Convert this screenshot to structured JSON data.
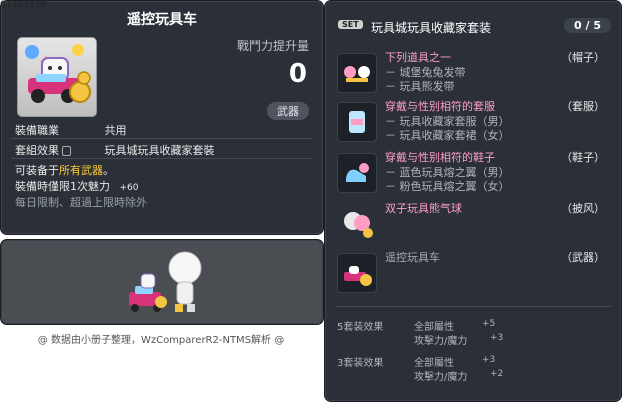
{
  "item_id": "01703339",
  "tooltip": {
    "title": "遥控玩具车",
    "attack_increase_label": "戰鬥力提升量",
    "attack_increase_value": "0",
    "type_badge": "武器",
    "job_label": "裝備職業",
    "job_value": "共用",
    "set_label": "套組效果",
    "set_value": "玩具城玩具收藏家套裝",
    "equip_prefix": "可装备于",
    "equip_weapon": "所有武器",
    "equip_suffix": "。",
    "time_limit_line": "裝備時僅限1次魅力",
    "charm_value": "+60",
    "daily_limit": "每日限制、超過上限時除外"
  },
  "footer": "@ 数据由小册子整理，WzComparerR2-NTMS解析 @",
  "set": {
    "tag": "SET",
    "name": "玩具城玩具收藏家套装",
    "count": "0 / 5",
    "items": [
      {
        "name": "下列道具之一",
        "slot": "（帽子）",
        "subs": [
          "－ 城堡兔兔发带",
          "－ 玩具熊发带"
        ],
        "color": "pink"
      },
      {
        "name": "穿戴与性别相符的套服",
        "slot": "（套服）",
        "subs": [
          "－ 玩具收藏家套服（男）",
          "－ 玩具收藏家套裙（女）"
        ],
        "color": "pink"
      },
      {
        "name": "穿戴与性别相符的鞋子",
        "slot": "（鞋子）",
        "subs": [
          "－ 蓝色玩具熔之翼（男）",
          "－ 粉色玩具熔之翼（女）"
        ],
        "color": "pink"
      },
      {
        "name": "双子玩具熊气球",
        "slot": "（披风）",
        "subs": [],
        "color": "pink"
      },
      {
        "name": "遥控玩具车",
        "slot": "（武器）",
        "subs": [],
        "color": "grey"
      }
    ],
    "effects": [
      {
        "level": "5套装效果",
        "stats": [
          {
            "name": "全部屬性",
            "value": "+5"
          },
          {
            "name": "攻擊力/魔力",
            "value": "+3"
          }
        ]
      },
      {
        "level": "3套装效果",
        "stats": [
          {
            "name": "全部屬性",
            "value": "+3"
          },
          {
            "name": "攻擊力/魔力",
            "value": "+2"
          }
        ]
      }
    ]
  },
  "colors": {
    "panel": "#2b3038",
    "gold": "#ffcc33",
    "pink": "#ff9ec4"
  }
}
